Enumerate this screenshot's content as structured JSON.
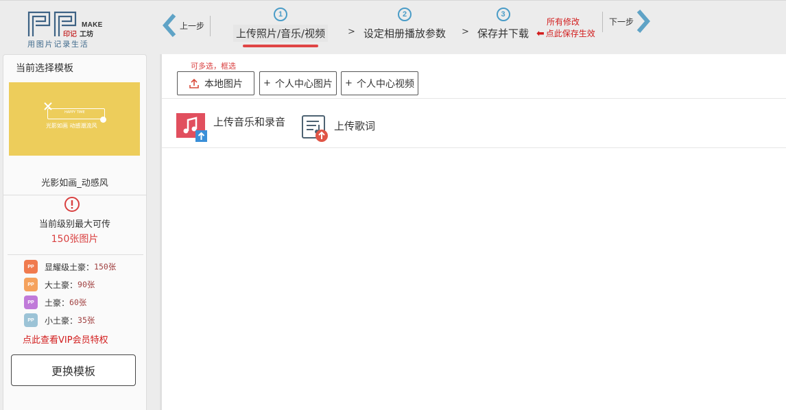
{
  "header": {
    "logo": {
      "make": "MAKE",
      "brand_red": "印记",
      "brand_dark": "工坊",
      "tagline": "用图片记录生活"
    },
    "prev_label": "上一步",
    "next_label": "下一步",
    "steps": [
      {
        "num": "1",
        "label": "上传照片/音乐/视频",
        "active": true
      },
      {
        "num": "2",
        "label": "设定相册播放参数",
        "active": false
      },
      {
        "num": "3",
        "label": "保存并下载",
        "active": false
      }
    ],
    "step_separator": ">",
    "save_note": {
      "line1": "所有修改",
      "line2": "点此保存生效"
    }
  },
  "sidebar": {
    "title": "当前选择模板",
    "thumbnail": {
      "frame_text": "HAPPY TIME",
      "caption": "光影如画  动感潮流风"
    },
    "template_name": "光影如画_动感风",
    "limit_label": "当前级别最大可传",
    "limit_value": "150张图片",
    "vip_levels": [
      {
        "name": "显耀级土豪：",
        "value": "150张",
        "color": "#f07b4e"
      },
      {
        "name": "大土豪：",
        "value": "90张",
        "color": "#f5a25d"
      },
      {
        "name": "土豪：",
        "value": "60张",
        "color": "#c07ad9"
      },
      {
        "name": "小土豪：",
        "value": "35张",
        "color": "#9cc3d6"
      }
    ],
    "vip_link": "点此查看VIP会员特权",
    "change_button": "更换模板"
  },
  "main": {
    "hint": "可多选，框选",
    "buttons": {
      "local": "本地图片",
      "center_images": "个人中心图片",
      "center_videos": "个人中心视频"
    },
    "upload_music": "上传音乐和录音",
    "upload_lyrics": "上传歌词"
  },
  "colors": {
    "accent_blue": "#4a9cc7",
    "accent_red": "#e04545",
    "note_red": "#d21c1c",
    "thumb_yellow": "#edcd5b"
  }
}
